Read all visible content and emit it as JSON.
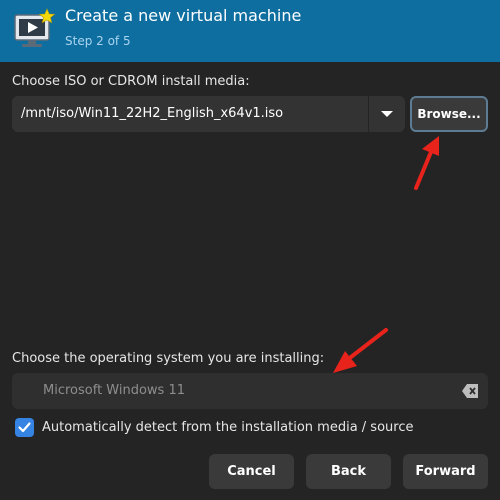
{
  "header": {
    "title": "Create a new virtual machine",
    "step": "Step 2 of 5",
    "icon": "virtual-machine-monitor-icon"
  },
  "install_media": {
    "label": "Choose ISO or CDROM install media:",
    "selected_path": "/mnt/iso/Win11_22H2_English_x64v1.iso",
    "browse_label": "Browse..."
  },
  "os": {
    "label": "Choose the operating system you are installing:",
    "search_placeholder": "Microsoft Windows 11",
    "autodetect_label": "Automatically detect from the installation media / source",
    "autodetect_checked": true
  },
  "buttons": {
    "cancel": "Cancel",
    "back": "Back",
    "forward": "Forward"
  },
  "colors": {
    "header_bg": "#0f6ea0",
    "accent": "#3584e4",
    "annotation_arrow": "#e8231b"
  }
}
